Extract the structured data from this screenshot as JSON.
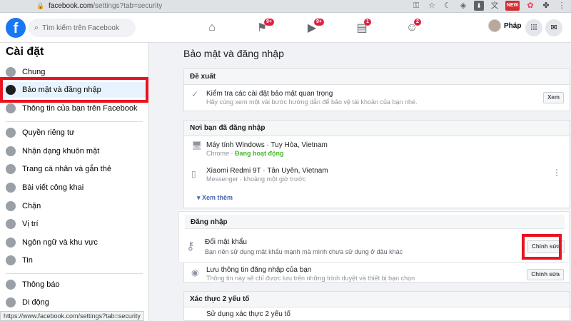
{
  "browser": {
    "url_host": "facebook.com",
    "url_path": "/settings?tab=security",
    "status_url": "https://www.facebook.com/settings?tab=security",
    "news_label": "NEW"
  },
  "header": {
    "logo": "f",
    "search_placeholder": "Tìm kiếm trên Facebook",
    "tabs": [
      {
        "name": "home",
        "badge": ""
      },
      {
        "name": "pages",
        "badge": "9+"
      },
      {
        "name": "watch",
        "badge": "9+"
      },
      {
        "name": "marketplace",
        "badge": "1"
      },
      {
        "name": "groups",
        "badge": "2"
      }
    ],
    "profile_name": "Pháp"
  },
  "sidebar": {
    "title": "Cài đặt",
    "items": [
      {
        "label": "Chung",
        "icon": "gear-icon"
      },
      {
        "label": "Bảo mật và đăng nhập",
        "icon": "shield-icon"
      },
      {
        "label": "Thông tin của bạn trên Facebook",
        "icon": "fb-icon"
      },
      {
        "label": "Quyền riêng tư",
        "icon": "lock-icon"
      },
      {
        "label": "Nhận dạng khuôn mặt",
        "icon": "face-icon"
      },
      {
        "label": "Trang cá nhân và gắn thẻ",
        "icon": "tag-icon"
      },
      {
        "label": "Bài viết công khai",
        "icon": "globe-icon"
      },
      {
        "label": "Chặn",
        "icon": "block-icon"
      },
      {
        "label": "Vị trí",
        "icon": "location-icon"
      },
      {
        "label": "Ngôn ngữ và khu vực",
        "icon": "language-icon"
      },
      {
        "label": "Tin",
        "icon": "story-icon"
      },
      {
        "label": "Thông báo",
        "icon": "bell-icon"
      },
      {
        "label": "Di động",
        "icon": "mobile-icon"
      }
    ]
  },
  "main": {
    "title": "Bảo mật và đăng nhập",
    "recommend": {
      "header": "Đề xuất",
      "title": "Kiểm tra các cài đặt bảo mật quan trọng",
      "desc": "Hãy cùng xem một vài bước hướng dẫn để bảo vệ tài khoản của bạn nhé.",
      "button": "Xem"
    },
    "logins": {
      "header": "Nơi bạn đã đăng nhập",
      "device1_title": "Máy tính Windows · Tuy Hòa, Vietnam",
      "device1_app": "Chrome · ",
      "device1_status": "Đang hoạt động",
      "device2_title": "Xiaomi Redmi 9T · Tân Uyên, Vietnam",
      "device2_desc": "Messenger · khoảng một giờ trước",
      "see_more": "▾  Xem thêm"
    },
    "login": {
      "header": "Đăng nhập",
      "change_pw_title": "Đổi mật khẩu",
      "change_pw_desc": "Bạn nên sử dụng mật khẩu mạnh mà mình chưa sử dụng ở đâu khác",
      "edit": "Chỉnh sửa",
      "save_login_title": "Lưu thông tin đăng nhập của bạn",
      "save_login_desc": "Thông tin này sẽ chỉ được lưu trên những trình duyệt và thiết bị bạn chọn",
      "edit2": "Chỉnh sửa"
    },
    "twofa": {
      "header": "Xác thực 2 yếu tố",
      "desc": "Sử dụng xác thực 2 yếu tố"
    }
  }
}
